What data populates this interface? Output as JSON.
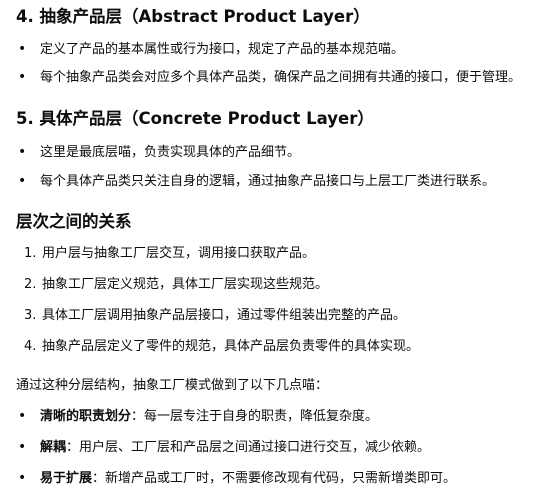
{
  "sections": [
    {
      "heading": "4. 抽象产品层（Abstract Product Layer）",
      "items": [
        "定义了产品的基本属性或行为接口，规定了产品的基本规范喵。",
        "每个抽象产品类会对应多个具体产品类，确保产品之间拥有共通的接口，便于管理。"
      ]
    },
    {
      "heading": "5. 具体产品层（Concrete Product Layer）",
      "items": [
        "这里是最底层喵，负责实现具体的产品细节。",
        "每个具体产品类只关注自身的逻辑，通过抽象产品接口与上层工厂类进行联系。"
      ]
    }
  ],
  "relations": {
    "heading": "层次之间的关系",
    "items": [
      {
        "num": "1.",
        "text": "用户层与抽象工厂层交互，调用接口获取产品。"
      },
      {
        "num": "2.",
        "text": "抽象工厂层定义规范，具体工厂层实现这些规范。"
      },
      {
        "num": "3.",
        "text": "具体工厂层调用抽象产品层接口，通过零件组装出完整的产品。"
      },
      {
        "num": "4.",
        "text": "抽象产品层定义了零件的规范，具体产品层负责零件的具体实现。"
      }
    ]
  },
  "summary": {
    "intro": "通过这种分层结构，抽象工厂模式做到了以下几点喵：",
    "points": [
      {
        "bold": "清晰的职责划分",
        "text": "：每一层专注于自身的职责，降低复杂度。"
      },
      {
        "bold": "解耦",
        "text": "：用户层、工厂层和产品层之间通过接口进行交互，减少依赖。"
      },
      {
        "bold": "易于扩展",
        "text": "：新增产品或工厂时，不需要修改现有代码，只需新增类即可。"
      }
    ]
  },
  "bullet_glyph": "•"
}
